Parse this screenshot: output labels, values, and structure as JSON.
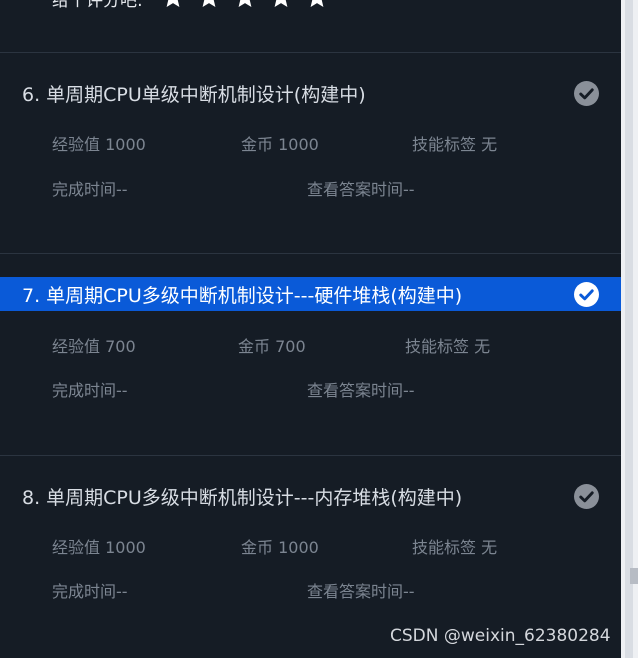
{
  "header": {
    "label": "给个评分吧:",
    "rating": 5,
    "star_color": "#ffffff"
  },
  "cards": [
    {
      "title": "6. 单周期CPU单级中断机制设计(构建中)",
      "selected": false,
      "exp": "经验值 1000",
      "coins": "金币 1000",
      "tags": "技能标签 无",
      "finish_time": "完成时间--",
      "view_answer_time": "查看答案时间--"
    },
    {
      "title": "7. 单周期CPU多级中断机制设计---硬件堆栈(构建中)",
      "selected": true,
      "exp": "经验值 700",
      "coins": "金币 700",
      "tags": "技能标签 无",
      "finish_time": "完成时间--",
      "view_answer_time": "查看答案时间--"
    },
    {
      "title": "8. 单周期CPU多级中断机制设计---内存堆栈(构建中)",
      "selected": false,
      "exp": "经验值 1000",
      "coins": "金币 1000",
      "tags": "技能标签 无",
      "finish_time": "完成时间--",
      "view_answer_time": "查看答案时间--"
    }
  ],
  "watermark": "CSDN @weixin_62380284",
  "colors": {
    "background": "#151c25",
    "selected_row": "#0a5ad8",
    "check_inactive": "#8a9099",
    "check_active": "#ffffff",
    "meta_text": "#7c8591"
  },
  "icons": {
    "check": "check-circle-icon",
    "star": "star-icon"
  }
}
